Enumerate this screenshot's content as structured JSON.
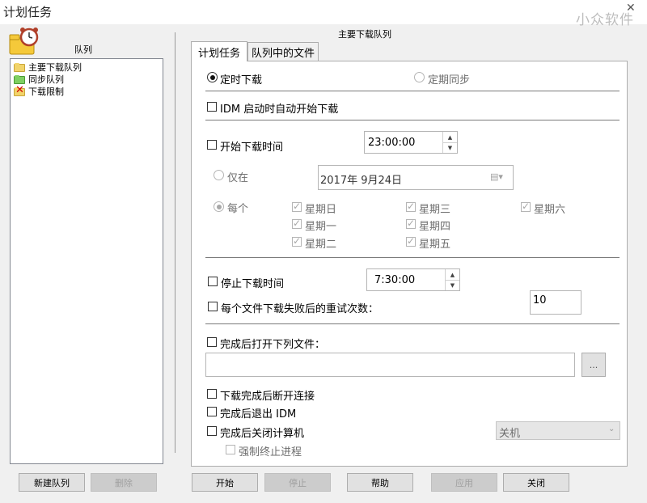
{
  "window": {
    "title": "计划任务",
    "watermark": "小众软件"
  },
  "left": {
    "header": "队列",
    "queues": [
      {
        "label": "主要下载队列",
        "icon": "folder-yellow-icon"
      },
      {
        "label": "同步队列",
        "icon": "folder-green-icon"
      },
      {
        "label": "下载限制",
        "icon": "folder-limit-icon"
      }
    ],
    "new_queue_button": "新建队列",
    "delete_button": "删除"
  },
  "right": {
    "header": "主要下载队列",
    "tabs": [
      "计划任务",
      "队列中的文件"
    ],
    "scheduled_download": "定时下载",
    "periodic_sync": "定期同步",
    "auto_start_idm": "IDM 启动时自动开始下载",
    "start_time_label": "开始下载时间",
    "start_time_value": "23:00:00",
    "only_on": "仅在",
    "date_value": "2017年  9月24日",
    "every": "每个",
    "days": {
      "sun": "星期日",
      "mon": "星期一",
      "tue": "星期二",
      "wed": "星期三",
      "thu": "星期四",
      "fri": "星期五",
      "sat": "星期六"
    },
    "stop_time_label": "停止下载时间",
    "stop_time_value": "7:30:00",
    "retry_label": "每个文件下载失败后的重试次数：",
    "retry_value": "10",
    "open_file_label": "完成后打开下列文件：",
    "open_file_path": "",
    "browse_button": "...",
    "disconnect_label": "下载完成后断开连接",
    "exit_idm_label": "完成后退出 IDM",
    "shutdown_label": "完成后关闭计算机",
    "shutdown_option": "关机",
    "force_terminate_label": "强制终止进程"
  },
  "buttons": {
    "start": "开始",
    "stop": "停止",
    "help": "帮助",
    "apply": "应用",
    "close": "关闭"
  }
}
